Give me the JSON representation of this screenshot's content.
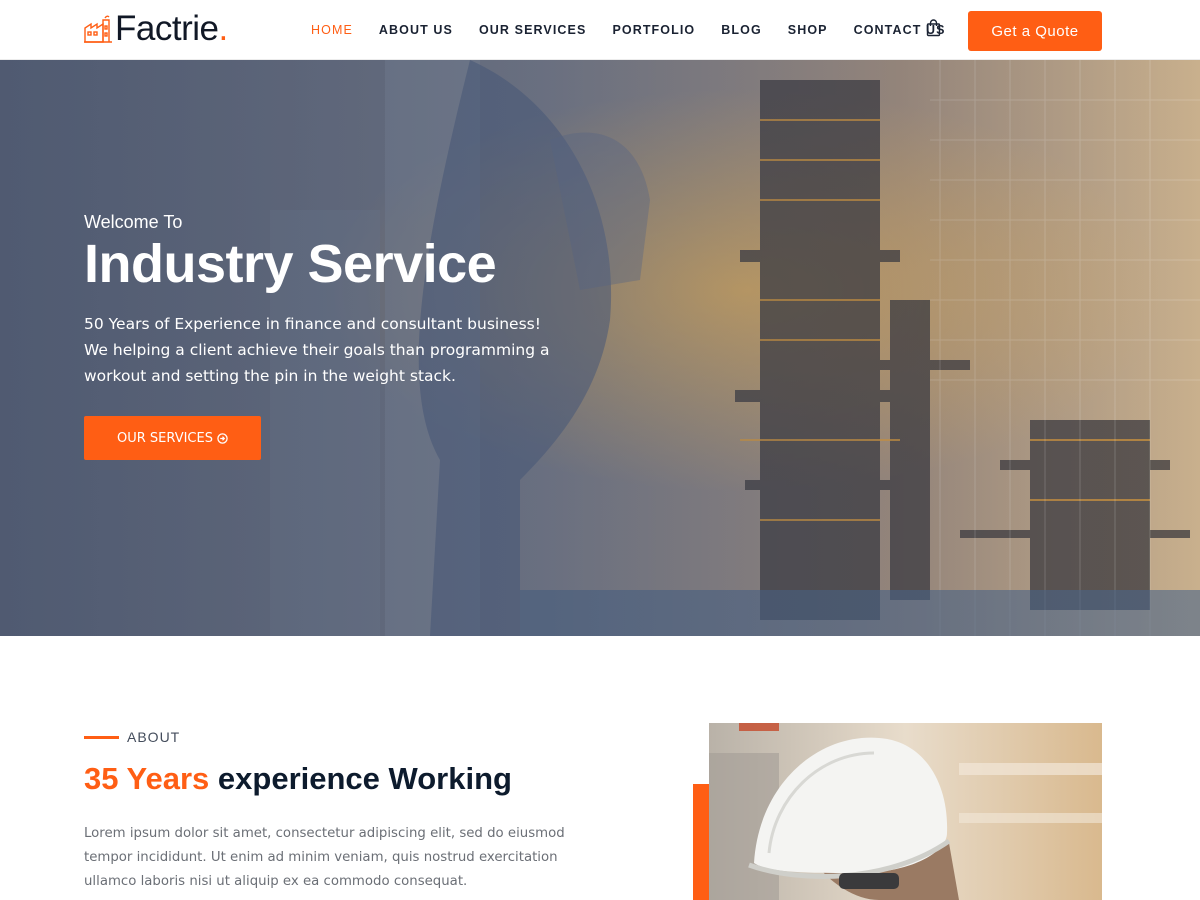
{
  "header": {
    "logo_text": "Factrie",
    "logo_dot": ".",
    "nav": [
      {
        "label": "HOME",
        "active": true
      },
      {
        "label": "ABOUT US",
        "active": false
      },
      {
        "label": "OUR SERVICES",
        "active": false
      },
      {
        "label": "PORTFOLIO",
        "active": false
      },
      {
        "label": "BLOG",
        "active": false
      },
      {
        "label": "SHOP",
        "active": false
      },
      {
        "label": "CONTACT US",
        "active": false
      }
    ],
    "cart_icon": "shopping-bag-icon",
    "quote_button": "Get a Quote"
  },
  "hero": {
    "welcome": "Welcome To",
    "title": "Industry Service",
    "description": "50 Years of Experience in finance and consultant business! We helping a client achieve their goals than programming a workout and setting the pin in the weight stack.",
    "button_label": "OUR SERVICES",
    "button_icon": "arrow-circle-right-icon"
  },
  "about": {
    "label": "ABOUT",
    "title_accent": "35 Years",
    "title_rest": " experience Working",
    "text": "Lorem ipsum dolor sit amet, consectetur adipiscing elit, sed do eiusmod tempor incididunt. Ut enim ad minim veniam, quis nostrud exercitation ullamco laboris nisi ut aliquip ex ea commodo consequat."
  },
  "colors": {
    "accent": "#ff5e14",
    "dark": "#0d1b2d"
  }
}
